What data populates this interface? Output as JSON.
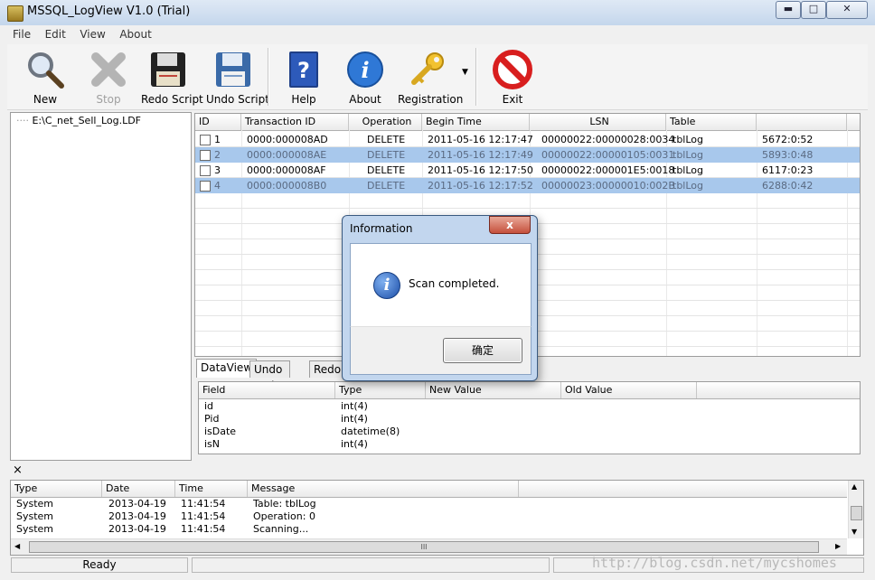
{
  "window": {
    "title": "MSSQL_LogView V1.0 (Trial)"
  },
  "menu": [
    "File",
    "Edit",
    "View",
    "About"
  ],
  "toolbar": {
    "new": "New",
    "stop": "Stop",
    "redo": "Redo Script",
    "undo": "Undo Script",
    "help": "Help",
    "about": "About",
    "registration": "Registration",
    "exit": "Exit"
  },
  "tree": {
    "item": "E:\\C_net_Sell_Log.LDF"
  },
  "grid": {
    "columns": [
      "ID",
      "Transaction ID",
      "Operation",
      "Begin Time",
      "LSN",
      "Table",
      ""
    ],
    "rows": [
      {
        "id": "1",
        "tid": "0000:000008AD",
        "op": "DELETE",
        "time": "2011-05-16 12:17:47",
        "lsn": "00000022:00000028:0034",
        "table": "tblLog",
        "extra": "5672:0:52",
        "selected": false
      },
      {
        "id": "2",
        "tid": "0000:000008AE",
        "op": "DELETE",
        "time": "2011-05-16 12:17:49",
        "lsn": "00000022:00000105:0031",
        "table": "tblLog",
        "extra": "5893:0:48",
        "selected": true
      },
      {
        "id": "3",
        "tid": "0000:000008AF",
        "op": "DELETE",
        "time": "2011-05-16 12:17:50",
        "lsn": "00000022:000001E5:0018",
        "table": "tblLog",
        "extra": "6117:0:23",
        "selected": false
      },
      {
        "id": "4",
        "tid": "0000:000008B0",
        "op": "DELETE",
        "time": "2011-05-16 12:17:52",
        "lsn": "00000023:00000010:002B",
        "table": "tblLog",
        "extra": "6288:0:42",
        "selected": true
      }
    ]
  },
  "tabs": [
    "DataView",
    "Undo Script",
    "Redo"
  ],
  "fields": {
    "columns": [
      "Field",
      "Type",
      "New Value",
      "Old Value"
    ],
    "rows": [
      {
        "field": "id",
        "type": "int(4)"
      },
      {
        "field": "Pid",
        "type": "int(4)"
      },
      {
        "field": "isDate",
        "type": "datetime(8)"
      },
      {
        "field": "isN",
        "type": "int(4)"
      }
    ]
  },
  "log": {
    "close": "×",
    "columns": [
      "Type",
      "Date",
      "Time",
      "Message"
    ],
    "rows": [
      {
        "type": "System",
        "date": "2013-04-19",
        "time": "11:41:54",
        "msg": "Table: tblLog"
      },
      {
        "type": "System",
        "date": "2013-04-19",
        "time": "11:41:54",
        "msg": "Operation: 0"
      },
      {
        "type": "System",
        "date": "2013-04-19",
        "time": "11:41:54",
        "msg": "Scanning..."
      }
    ],
    "scroll_grip": "III"
  },
  "status": {
    "text": "Ready"
  },
  "watermark": "http://blog.csdn.net/mycshomes",
  "dialog": {
    "title": "Information",
    "message": "Scan completed.",
    "ok": "确定",
    "close": "x"
  },
  "colors": {
    "selection": "#a8c8ec",
    "exit_red": "#d81e1e",
    "info_blue": "#1c4ea8"
  }
}
